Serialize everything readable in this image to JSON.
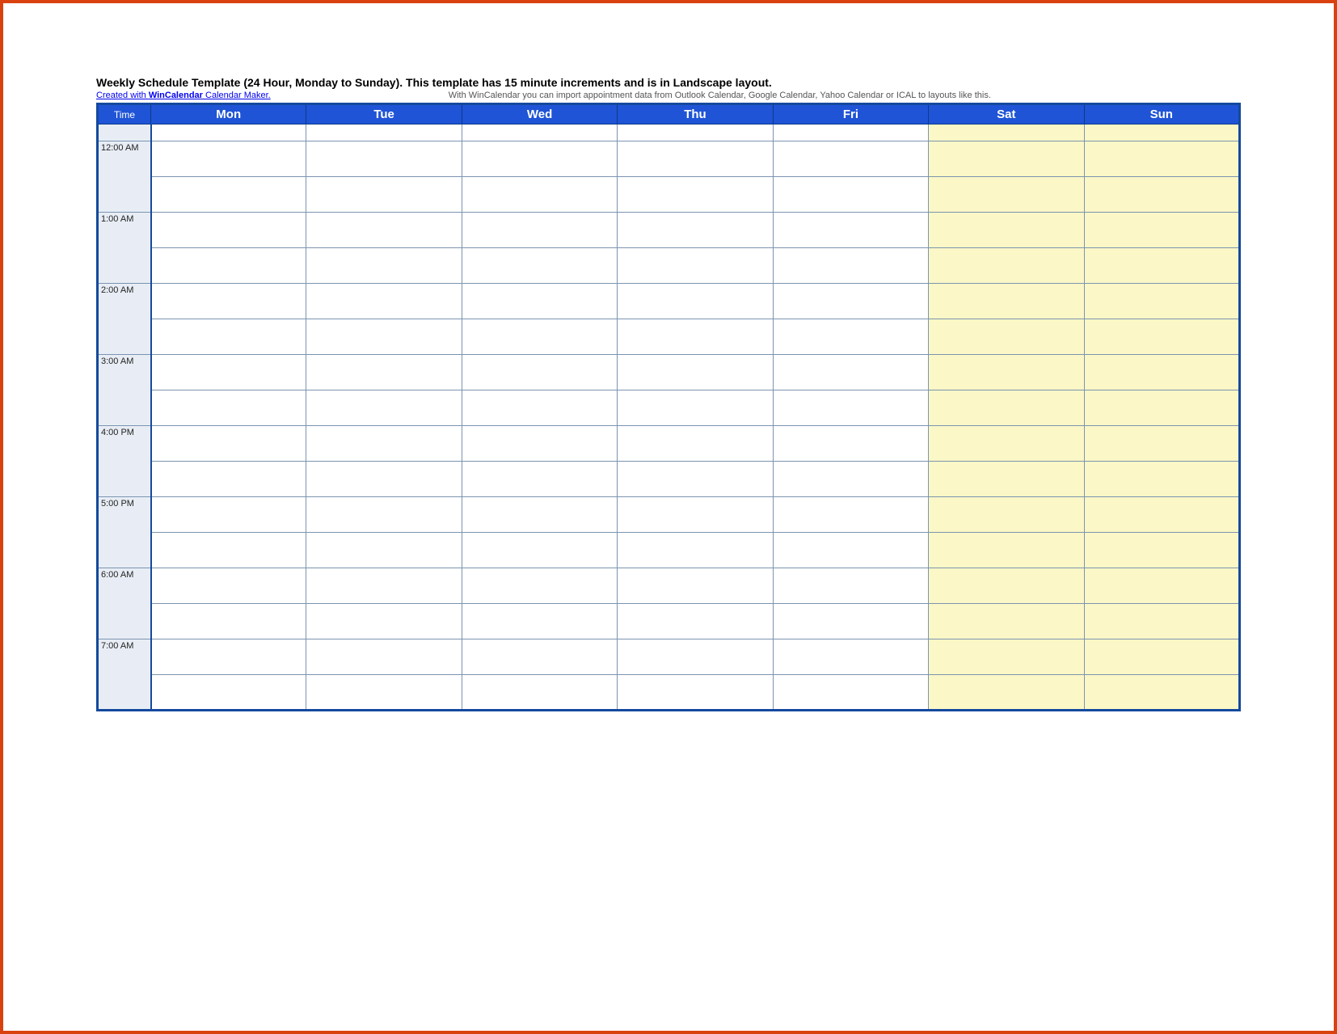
{
  "header": {
    "title": "Weekly Schedule Template (24 Hour, Monday to Sunday).  This template has 15 minute increments and is in Landscape layout.",
    "credit_prefix": "Created with ",
    "credit_brand": "WinCalendar",
    "credit_suffix": " Calendar Maker.",
    "subtitle": "With WinCalendar you can import appointment data from Outlook Calendar, Google Calendar, Yahoo Calendar or ICAL to layouts like this."
  },
  "columns": {
    "time": "Time",
    "days": [
      "Mon",
      "Tue",
      "Wed",
      "Thu",
      "Fri",
      "Sat",
      "Sun"
    ]
  },
  "times": [
    "12:00 AM",
    "1:00 AM",
    "2:00 AM",
    "3:00 AM",
    "4:00 PM",
    "5:00 PM",
    "6:00 AM",
    "7:00 AM"
  ]
}
